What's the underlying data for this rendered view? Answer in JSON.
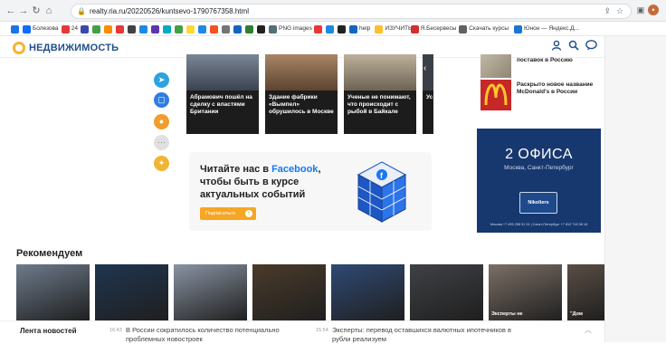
{
  "browser": {
    "url": "realty.ria.ru/20220526/kuntsevo-1790767358.html",
    "bookmarks": [
      {
        "label": "",
        "color": "#1a73e8"
      },
      {
        "label": "Болезова",
        "color": "#0d6efd"
      },
      {
        "label": "24",
        "color": "#e53935"
      },
      {
        "label": "",
        "color": "#3949ab"
      },
      {
        "label": "",
        "color": "#43a047"
      },
      {
        "label": "",
        "color": "#fb8c00"
      },
      {
        "label": "",
        "color": "#e53935"
      },
      {
        "label": "",
        "color": "#424242"
      },
      {
        "label": "",
        "color": "#1e88e5"
      },
      {
        "label": "",
        "color": "#5e35b1"
      },
      {
        "label": "",
        "color": "#00acc1"
      },
      {
        "label": "",
        "color": "#43a047"
      },
      {
        "label": "",
        "color": "#fdd835"
      },
      {
        "label": "",
        "color": "#1e88e5"
      },
      {
        "label": "",
        "color": "#f4511e"
      },
      {
        "label": "",
        "color": "#757575"
      },
      {
        "label": "",
        "color": "#1565c0"
      },
      {
        "label": "",
        "color": "#2e7d32"
      },
      {
        "label": "",
        "color": "#212121"
      },
      {
        "label": "PNG images",
        "color": "#546e7a"
      },
      {
        "label": "",
        "color": "#e53935"
      },
      {
        "label": "",
        "color": "#1e88e5"
      },
      {
        "label": "",
        "color": "#212121"
      },
      {
        "label": "help",
        "color": "#1565c0"
      },
      {
        "label": "ИЗУЧИТЬ",
        "color": "#fbc02d"
      },
      {
        "label": "Я.Бесервесы",
        "color": "#d32f2f"
      },
      {
        "label": "Скачать курсы",
        "color": "#616161"
      },
      {
        "label": "Юнон — Яндекс.Д...",
        "color": "#1976d2"
      }
    ]
  },
  "site": {
    "logo_text": "НЕДВИЖИМОСТЬ",
    "share_colors": [
      "#2ea3e0",
      "#2f7de1",
      "#f39c2b",
      "#e0e0e0",
      "#f2b533"
    ]
  },
  "cards": [
    {
      "caption": "Абрамович пошёл на сделку с властями Британии",
      "color": "#5b6673"
    },
    {
      "caption": "Здание фабрики «Вымпел» обрушилось в Москве",
      "color": "#8c6a4f"
    },
    {
      "caption": "Ученые не понимают, что происходит с рыбой в Байкале",
      "color": "#9a8f7d"
    },
    {
      "caption": "Ус",
      "color": "#3b4048"
    }
  ],
  "side_news": [
    {
      "text": "поставок в Россию",
      "color": "#a49a8a"
    },
    {
      "text": "Раскрыто новое название McDonald's в России",
      "color": "#c62828"
    }
  ],
  "promo": {
    "line1": "Читайте нас в ",
    "brand": "Facebook",
    "line1_end": ",",
    "line2": "чтобы быть в курсе актуальных событий",
    "button": "Подписаться"
  },
  "ad": {
    "big": "2 ОФИСА",
    "sub": "Москва, Санкт-Петербург",
    "brand": "Nikoliers",
    "phones": "Москва +7 495 258 51 51  |  Санкт-Петербург +7 812 718 36 18"
  },
  "recommend": {
    "title": "Рекомендуем",
    "items": [
      {
        "caption": "",
        "color": "#6e7b8c"
      },
      {
        "caption": "",
        "color": "#1f3550"
      },
      {
        "caption": "",
        "color": "#8a94a3"
      },
      {
        "caption": "",
        "color": "#4a3b2a"
      },
      {
        "caption": "",
        "color": "#2f4a74"
      },
      {
        "caption": "",
        "color": "#3f4145"
      },
      {
        "caption": "Эксперты не",
        "color": "#7c6f66"
      },
      {
        "caption": "\"Дом",
        "color": "#5a4e45"
      }
    ]
  },
  "ticker": {
    "label": "Лента новостей",
    "items": [
      {
        "time": "16:43",
        "text": "В России сократилось количество потенциально проблемных новостроек"
      },
      {
        "time": "15:54",
        "text": "Эксперты: перевод оставшихся валютных ипотечников в рубли реализуем"
      }
    ]
  }
}
